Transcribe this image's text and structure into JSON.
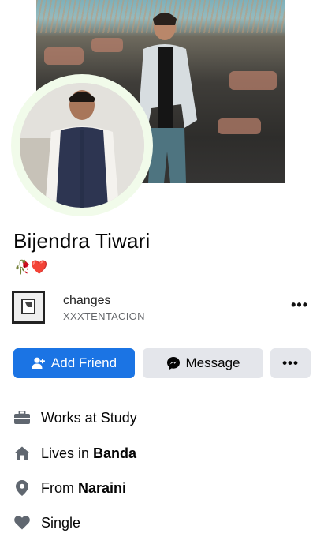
{
  "profile": {
    "name": "Bijendra Tiwari",
    "bio_emoji": "🥀❤️"
  },
  "music": {
    "title": "changes",
    "artist": "XXXTENTACION",
    "more_label": "•••"
  },
  "actions": {
    "add_friend_label": "Add Friend",
    "message_label": "Message",
    "more_label": "•••",
    "add_friend_color": "#1b74e4",
    "secondary_color": "#e4e6eb"
  },
  "details": [
    {
      "icon": "briefcase-icon",
      "prefix": "Works at ",
      "value": "Study",
      "value_bold": false
    },
    {
      "icon": "home-icon",
      "prefix": "Lives in ",
      "value": "Banda",
      "value_bold": true
    },
    {
      "icon": "location-pin-icon",
      "prefix": "From ",
      "value": "Naraini",
      "value_bold": true
    },
    {
      "icon": "heart-icon",
      "prefix": "",
      "value": "Single",
      "value_bold": false
    }
  ]
}
